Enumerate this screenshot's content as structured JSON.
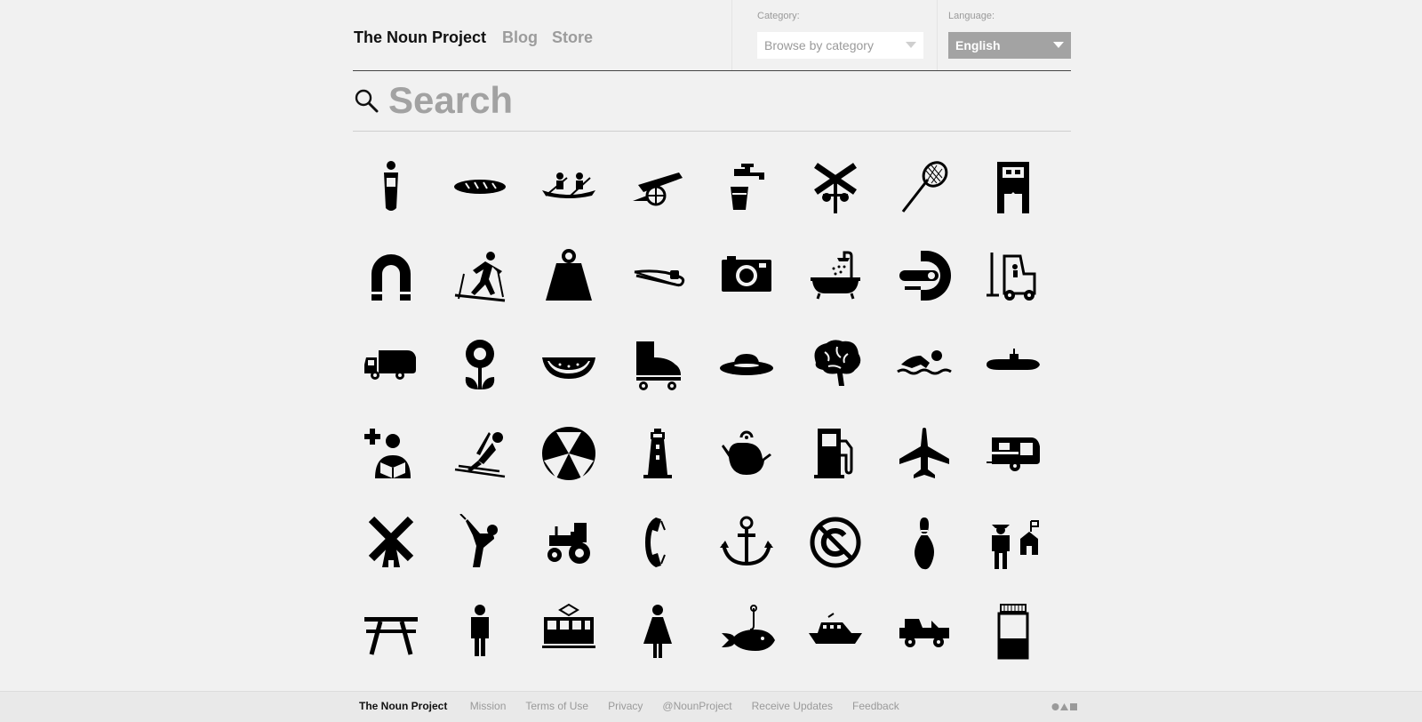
{
  "header": {
    "brand": "The Noun Project",
    "nav": {
      "blog": "Blog",
      "store": "Store"
    },
    "category": {
      "label": "Category:",
      "value": "Browse by category"
    },
    "language": {
      "label": "Language:",
      "value": "English"
    }
  },
  "search": {
    "placeholder": "Search"
  },
  "icons": [
    "person-in-sleeping-bag",
    "baguette",
    "rowing-canoe",
    "cannon",
    "water-tap",
    "railroad-crossing",
    "badminton-racket",
    "vending-machine",
    "magnet",
    "cross-country-skier",
    "weight",
    "safety-pin",
    "camera",
    "shower-bathtub",
    "mri-scanner",
    "forklift",
    "garbage-truck",
    "flower",
    "watermelon-slice",
    "roller-skate",
    "ufo",
    "brain",
    "swimmer",
    "submarine",
    "first-aid-reader",
    "ski-jumper",
    "fallout-shelter",
    "lighthouse",
    "teapot",
    "gas-pump",
    "airplane",
    "camper-trailer",
    "windmill",
    "golfer",
    "tractor",
    "telephone-receiver",
    "anchor",
    "no-copyright",
    "bowling-pin",
    "farmer",
    "picnic-table",
    "man",
    "tram",
    "woman",
    "fish-on-hook",
    "boat",
    "jeep",
    "medicine-bottle"
  ],
  "footer": {
    "brand": "The Noun Project",
    "links": [
      "Mission",
      "Terms of Use",
      "Privacy",
      "@NounProject",
      "Receive Updates",
      "Feedback"
    ],
    "shapes_icon": "circle-triangle-square-icon"
  }
}
